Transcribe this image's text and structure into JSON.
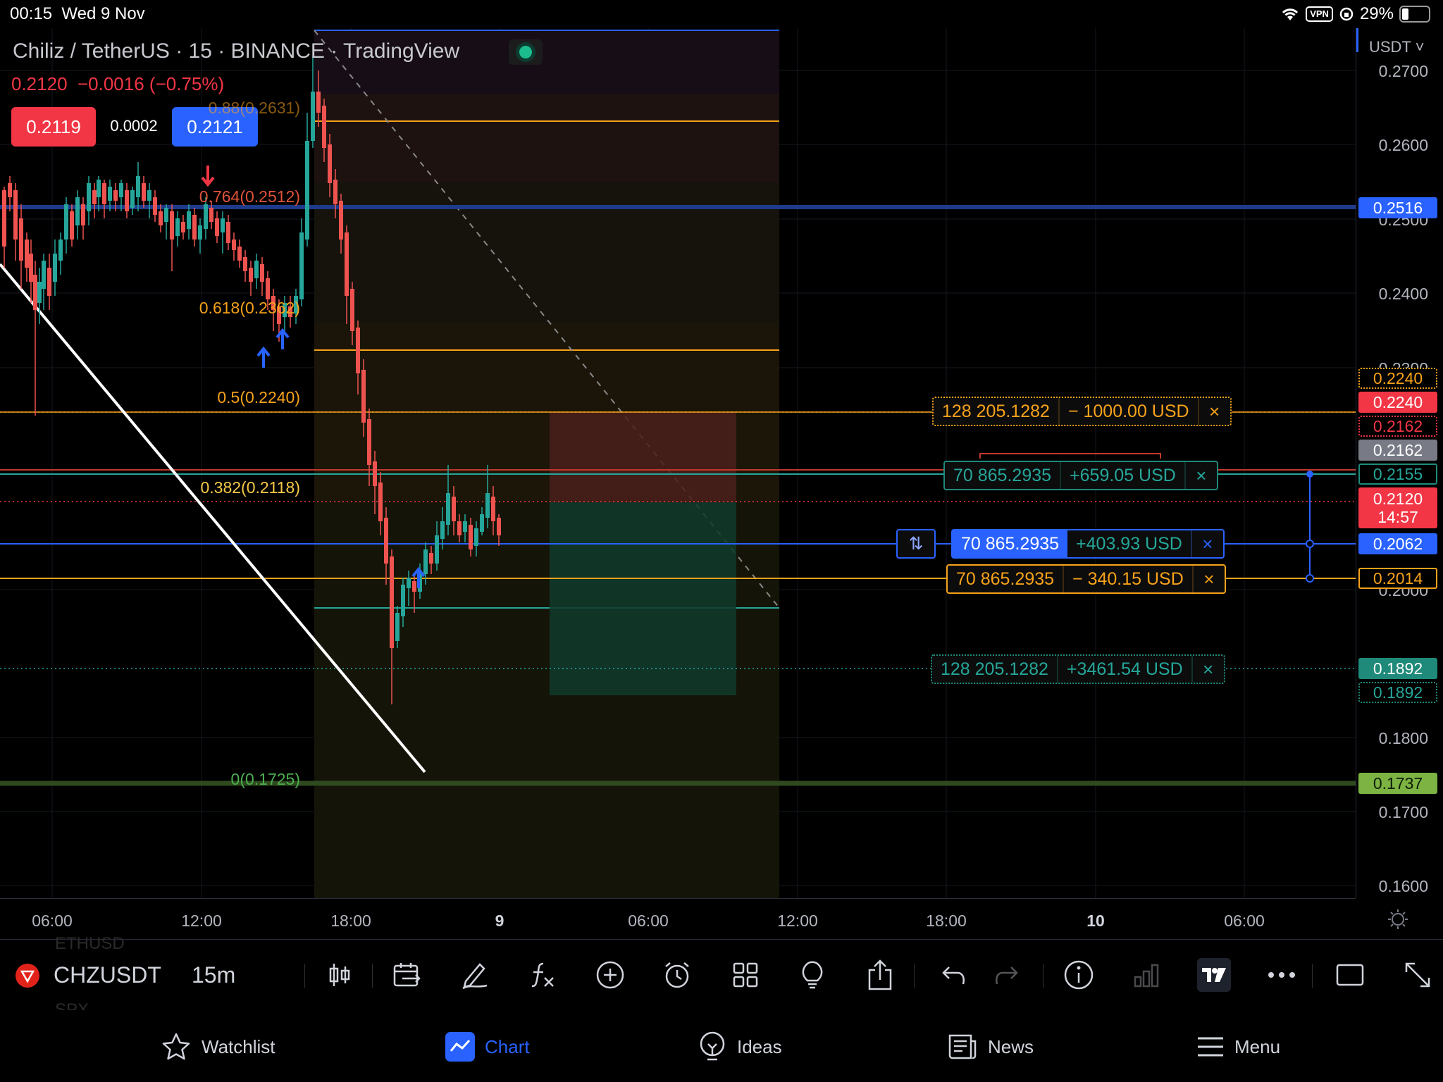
{
  "status_bar": {
    "time": "00:15",
    "date": "Wed 9 Nov",
    "vpn": "VPN",
    "battery": "29%"
  },
  "header": {
    "symbol": "Chiliz / TetherUS · 15 · BINANCE · TradingView",
    "price": "0.2120",
    "change": "−0.0016 (−0.75%)",
    "sell_price": "0.2119",
    "spread": "0.0002",
    "buy_price": "0.2121"
  },
  "colors": {
    "up": "#26a69a",
    "down": "#ef5350",
    "accent": "#2962ff",
    "fib_orange": "#f7a21b",
    "fib_green": "#4caf50",
    "fib_red": "#e0533a"
  },
  "fib_levels": [
    {
      "label": "0.88(0.2631)"
    },
    {
      "label": "0.764(0.2512)"
    },
    {
      "label": "0.618(0.2362)"
    },
    {
      "label": "0.5(0.2240)"
    },
    {
      "label": "0.382(0.2118)"
    },
    {
      "label": "0(0.1725)"
    }
  ],
  "orders": [
    {
      "qty": "128 205.1282",
      "pnl": "− 1000.00 USD",
      "close": "×"
    },
    {
      "qty": "70 865.2935",
      "pnl": "+659.05 USD",
      "close": "×"
    },
    {
      "qty": "70 865.2935",
      "pnl": "+403.93 USD",
      "close": "×",
      "handle": "⇅"
    },
    {
      "qty": "70 865.2935",
      "pnl": "− 340.15 USD",
      "close": "×"
    },
    {
      "qty": "128 205.1282",
      "pnl": "+3461.54 USD",
      "close": "×"
    }
  ],
  "price_axis": {
    "currency": "USDT",
    "ticks": [
      "0.2700",
      "0.2600",
      "0.2500",
      "0.2400",
      "0.2300",
      "0.2000",
      "0.1800",
      "0.1700",
      "0.1600"
    ],
    "badges": [
      "0.2516",
      "0.2240",
      "0.2240",
      "0.2162",
      "0.2162",
      "0.2155",
      "0.2120",
      "14:57",
      "0.2062",
      "0.2014",
      "0.1892",
      "0.1892",
      "0.1737"
    ]
  },
  "time_axis": [
    "06:00",
    "12:00",
    "18:00",
    "9",
    "06:00",
    "12:00",
    "18:00",
    "10",
    "06:00"
  ],
  "toolbar": {
    "symbol": "CHZUSDT",
    "interval": "15m",
    "ghost_above": "ETHUSD",
    "ghost_below": "SPX"
  },
  "toolbar_icons": [
    "candles-icon",
    "replay-icon",
    "draw-icon",
    "indicators-icon",
    "add-icon",
    "alert-icon",
    "layout-icon",
    "ideas-icon",
    "share-icon",
    "undo-icon",
    "redo-icon",
    "info-icon",
    "stats-icon",
    "tradingview-icon",
    "more-icon",
    "fullscreen-icon",
    "expand-icon"
  ],
  "nav": [
    {
      "label": "Watchlist",
      "icon": "star-icon"
    },
    {
      "label": "Chart",
      "icon": "chart-icon",
      "active": true
    },
    {
      "label": "Ideas",
      "icon": "bulb-icon"
    },
    {
      "label": "News",
      "icon": "news-icon"
    },
    {
      "label": "Menu",
      "icon": "menu-icon"
    }
  ]
}
